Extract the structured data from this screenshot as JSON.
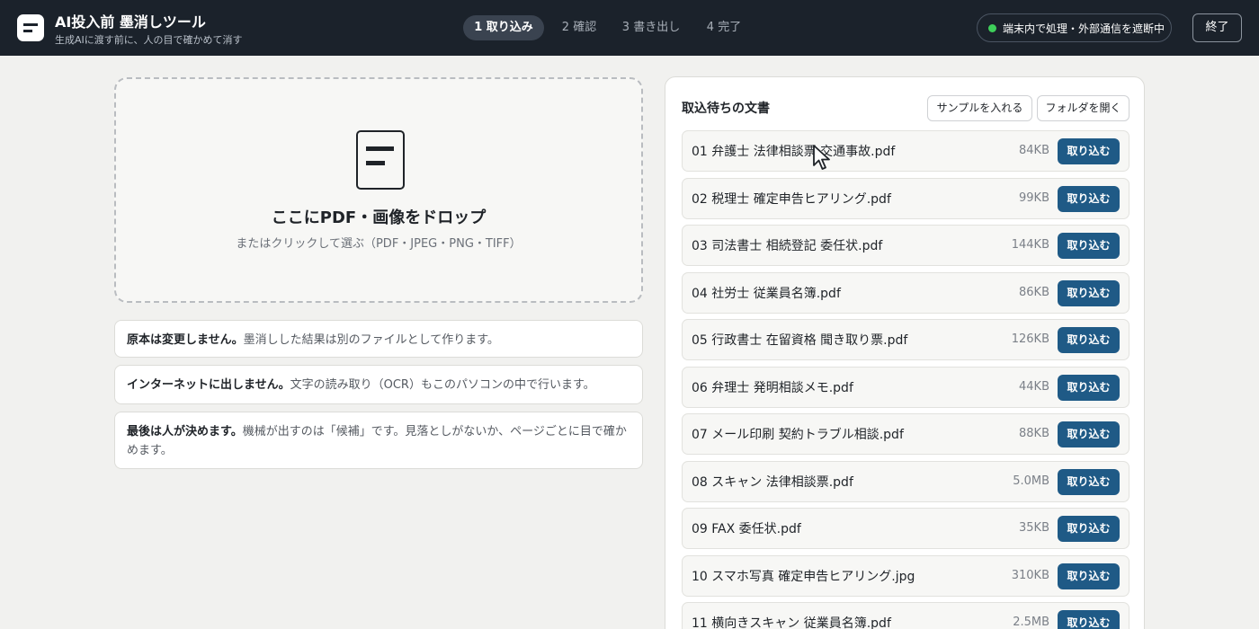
{
  "header": {
    "title": "AI投入前 墨消しツール",
    "subtitle": "生成AIに渡す前に、人の目で確かめて消す",
    "steps": [
      "1 取り込み",
      "2 確認",
      "3 書き出し",
      "4 完了"
    ],
    "active_step": 0,
    "status_text": "端末内で処理・外部通信を遮断中",
    "end_label": "終了"
  },
  "dropzone": {
    "title": "ここにPDF・画像をドロップ",
    "subtitle": "またはクリックして選ぶ（PDF・JPEG・PNG・TIFF）"
  },
  "info_cards": [
    {
      "bold": "原本は変更しません。",
      "text": "墨消しした結果は別のファイルとして作ります。"
    },
    {
      "bold": "インターネットに出しません。",
      "text": "文字の読み取り（OCR）もこのパソコンの中で行います。"
    },
    {
      "bold": "最後は人が決めます。",
      "text": "機械が出すのは「候補」です。見落としがないか、ページごとに目で確かめます。"
    }
  ],
  "queue": {
    "title": "取込待ちの文書",
    "sample_label": "サンプルを入れる",
    "open_folder_label": "フォルダを開く",
    "import_label": "取り込む",
    "files": [
      {
        "name": "01 弁護士 法律相談票 交通事故.pdf",
        "size": "84KB"
      },
      {
        "name": "02 税理士 確定申告ヒアリング.pdf",
        "size": "99KB"
      },
      {
        "name": "03 司法書士 相続登記 委任状.pdf",
        "size": "144KB"
      },
      {
        "name": "04 社労士 従業員名簿.pdf",
        "size": "86KB"
      },
      {
        "name": "05 行政書士 在留資格 聞き取り票.pdf",
        "size": "126KB"
      },
      {
        "name": "06 弁理士 発明相談メモ.pdf",
        "size": "44KB"
      },
      {
        "name": "07 メール印刷 契約トラブル相談.pdf",
        "size": "88KB"
      },
      {
        "name": "08 スキャン 法律相談票.pdf",
        "size": "5.0MB"
      },
      {
        "name": "09 FAX 委任状.pdf",
        "size": "35KB"
      },
      {
        "name": "10 スマホ写真 確定申告ヒアリング.jpg",
        "size": "310KB"
      },
      {
        "name": "11 横向きスキャン 従業員名簿.pdf",
        "size": "2.5MB"
      }
    ]
  },
  "colors": {
    "header_bg": "#1b222b",
    "accent": "#1f5a86",
    "status_dot": "#3ecf5a"
  },
  "icons": [
    "app-logo-icon",
    "document-icon",
    "status-dot-icon",
    "mouse-cursor-icon"
  ]
}
